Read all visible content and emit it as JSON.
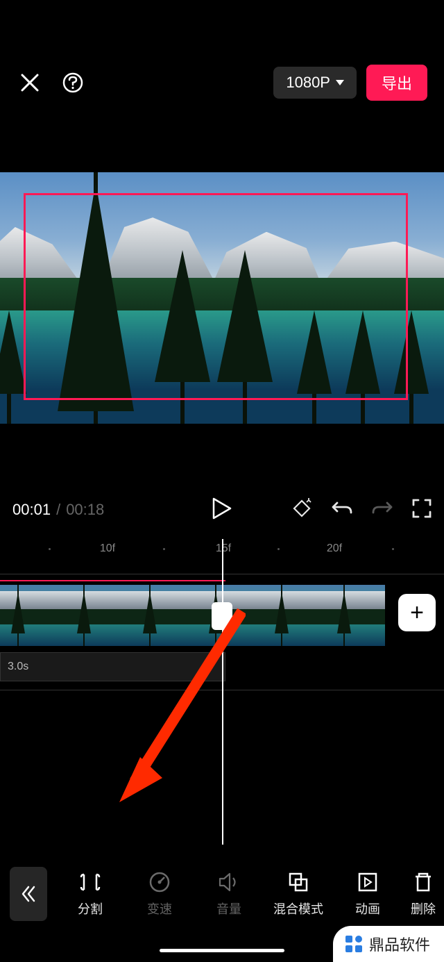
{
  "header": {
    "resolution_label": "1080P",
    "export_label": "导出"
  },
  "playback": {
    "current_time": "00:01",
    "separator": "/",
    "total_time": "00:18"
  },
  "ruler": {
    "ticks": [
      "10f",
      "15f",
      "20f"
    ]
  },
  "timeline": {
    "subtrack_duration": "3.0s",
    "add_label": "+"
  },
  "toolbar": {
    "items": [
      {
        "id": "split",
        "label": "分割",
        "dim": false
      },
      {
        "id": "speed",
        "label": "变速",
        "dim": true
      },
      {
        "id": "volume",
        "label": "音量",
        "dim": true
      },
      {
        "id": "blend",
        "label": "混合模式",
        "dim": false
      },
      {
        "id": "anim",
        "label": "动画",
        "dim": false
      },
      {
        "id": "delete",
        "label": "删除",
        "dim": false
      }
    ]
  },
  "watermark": {
    "text": "鼎品软件"
  }
}
